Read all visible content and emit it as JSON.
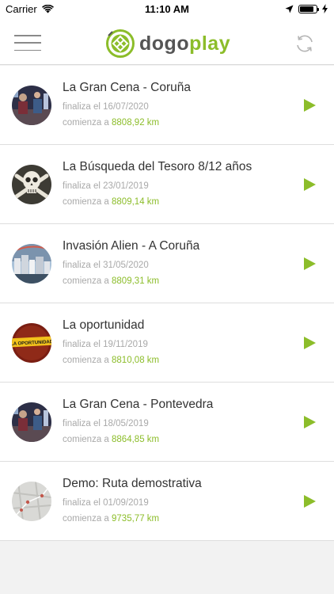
{
  "status_bar": {
    "carrier": "Carrier",
    "time": "11:10 AM"
  },
  "header": {
    "logo_part1": "dogo",
    "logo_part2": "play",
    "menu_icon": "hamburger-menu-icon",
    "refresh_icon": "refresh-icon",
    "accent_color": "#8cbd2a"
  },
  "games": [
    {
      "title": "La Gran Cena - Coruña",
      "end_prefix": "finaliza el",
      "end_date": "16/07/2020",
      "start_prefix": "comienza a",
      "distance": "8808,92 km",
      "avatar": "dinner-photo"
    },
    {
      "title": "La Búsqueda del Tesoro 8/12 años",
      "end_prefix": "finaliza el",
      "end_date": "23/01/2019",
      "start_prefix": "comienza a",
      "distance": "8809,14 km",
      "avatar": "skull-crossbones"
    },
    {
      "title": "Invasión Alien - A Coruña",
      "end_prefix": "finaliza el",
      "end_date": "31/05/2020",
      "start_prefix": "comienza a",
      "distance": "8809,31 km",
      "avatar": "city-photo"
    },
    {
      "title": "La oportunidad",
      "end_prefix": "finaliza el",
      "end_date": "19/11/2019",
      "start_prefix": "comienza a",
      "distance": "8810,08 km",
      "avatar": "la-oportunidad-tape",
      "avatar_text": "LA OPORTUNIDAD"
    },
    {
      "title": "La Gran Cena - Pontevedra",
      "end_prefix": "finaliza el",
      "end_date": "18/05/2019",
      "start_prefix": "comienza a",
      "distance": "8864,85 km",
      "avatar": "dinner-photo"
    },
    {
      "title": "Demo: Ruta demostrativa",
      "end_prefix": "finaliza el",
      "end_date": "01/09/2019",
      "start_prefix": "comienza a",
      "distance": "9735,77 km",
      "avatar": "map-thumbnail"
    }
  ]
}
